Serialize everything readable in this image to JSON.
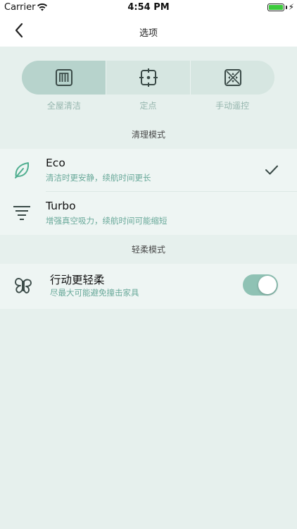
{
  "status_bar": {
    "carrier": "Carrier",
    "time": "4:54 PM"
  },
  "nav": {
    "title": "选项",
    "back_icon": "chevron-left-icon"
  },
  "segments": [
    {
      "label": "全屋清洁",
      "icon": "full-house-icon",
      "selected": true
    },
    {
      "label": "定点",
      "icon": "spot-target-icon",
      "selected": false
    },
    {
      "label": "手动遥控",
      "icon": "manual-remote-icon",
      "selected": false
    }
  ],
  "clean_mode": {
    "section_title": "清理模式",
    "options": [
      {
        "title": "Eco",
        "subtitle": "清洁时更安静，续航时间更长",
        "icon": "leaf-icon",
        "checked": true
      },
      {
        "title": "Turbo",
        "subtitle": "增强真空吸力，续航时间可能缩短",
        "icon": "turbo-lines-icon",
        "checked": false
      }
    ]
  },
  "gentle_mode": {
    "section_title": "轻柔模式",
    "title": "行动更轻柔",
    "subtitle": "尽最大可能避免撞击家具",
    "icon": "butterfly-icon",
    "enabled": true
  },
  "colors": {
    "accent": "#8fc2b4",
    "subtitle_text": "#69a99a",
    "background": "#e6f0ed",
    "icon_dark": "#3a4a47",
    "leaf_green": "#4fae8f"
  }
}
